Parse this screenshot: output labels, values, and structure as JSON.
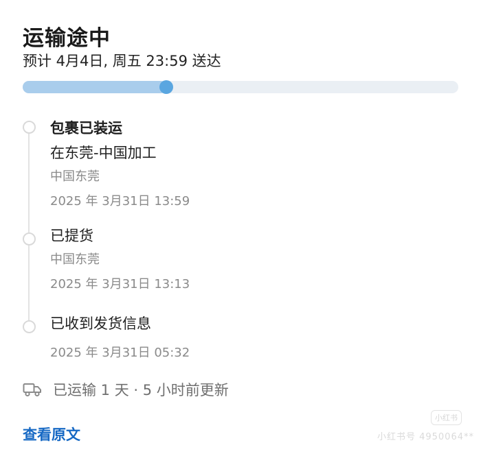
{
  "header": {
    "status_title": "运输途中",
    "eta": "预计 4月4日, 周五 23:59 送达"
  },
  "progress": {
    "fraction": 0.33,
    "colors": {
      "track": "#eaeff4",
      "fill": "#a9cdec",
      "knob": "#5aa6e0"
    }
  },
  "timeline": [
    {
      "title": "包裹已装运",
      "subtitle": "在东莞-中国加工",
      "location": "中国东莞",
      "time": "2025 年 3月31日  13:59",
      "bold": true
    },
    {
      "title": "已提货",
      "location": "中国东莞",
      "time": "2025 年 3月31日  13:13"
    },
    {
      "title": "已收到发货信息",
      "time": "2025 年 3月31日  05:32"
    }
  ],
  "summary": {
    "icon": "truck-icon",
    "text": "已运输 1 天 · 5 小时前更新"
  },
  "link": {
    "view_original": "查看原文",
    "color": "#1769c4"
  },
  "watermark": {
    "logo": "小红书",
    "text": "小红书号 4950064**"
  }
}
